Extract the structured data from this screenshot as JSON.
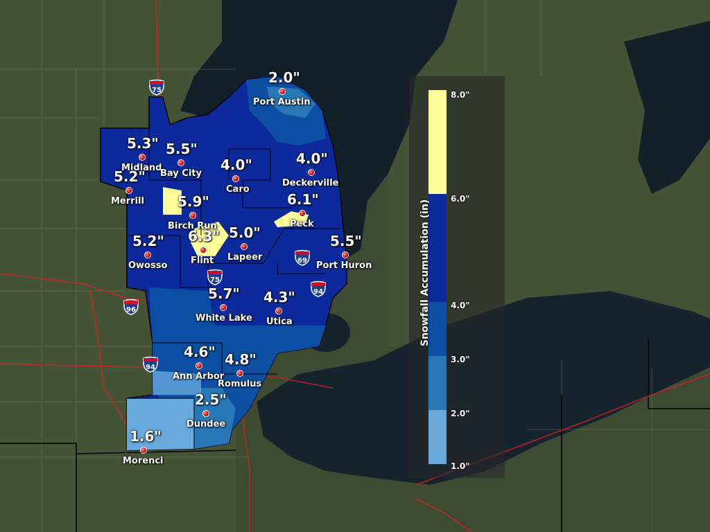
{
  "legend": {
    "title": "Snowfall Accumulation (in)",
    "ticks": [
      "8.0\"",
      "6.0\"",
      "4.0\"",
      "3.0\"",
      "2.0\"",
      "1.0\""
    ],
    "colors": [
      "#ffff99",
      "#0c2a9c",
      "#0b4ea2",
      "#2878b8",
      "#67a9dd"
    ]
  },
  "cities": [
    {
      "name": "Port Austin",
      "value": "2.0\""
    },
    {
      "name": "Midland",
      "value": "5.3\""
    },
    {
      "name": "Bay City",
      "value": "5.5\""
    },
    {
      "name": "Caro",
      "value": "4.0\""
    },
    {
      "name": "Deckerville",
      "value": "4.0\""
    },
    {
      "name": "Merrill",
      "value": "5.2\""
    },
    {
      "name": "Birch Run",
      "value": "5.9\""
    },
    {
      "name": "Peck",
      "value": "6.1\""
    },
    {
      "name": "Owosso",
      "value": "5.2\""
    },
    {
      "name": "Flint",
      "value": "6.3\""
    },
    {
      "name": "Lapeer",
      "value": "5.0\""
    },
    {
      "name": "Port Huron",
      "value": "5.5\""
    },
    {
      "name": "White Lake",
      "value": "5.7\""
    },
    {
      "name": "Utica",
      "value": "4.3\""
    },
    {
      "name": "Ann Arbor",
      "value": "4.6\""
    },
    {
      "name": "Romulus",
      "value": "4.8\""
    },
    {
      "name": "Dundee",
      "value": "2.5\""
    },
    {
      "name": "Morenci",
      "value": "1.6\""
    }
  ],
  "shields": [
    "75",
    "75",
    "69",
    "94",
    "96",
    "94"
  ]
}
